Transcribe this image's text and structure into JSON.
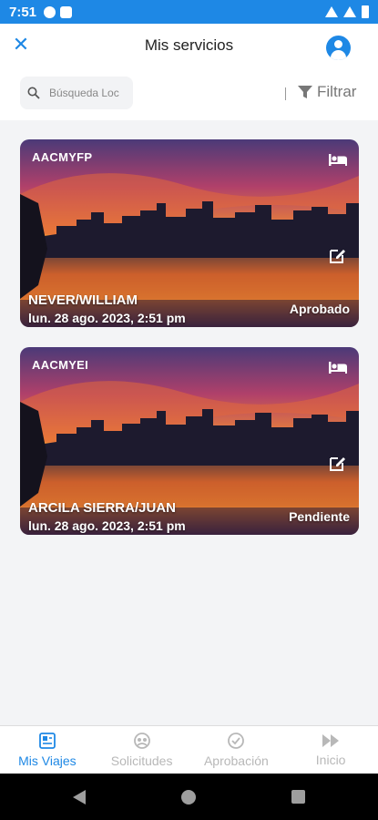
{
  "status_bar": {
    "time": "7:51"
  },
  "header": {
    "title": "Mis servicios",
    "search_placeholder": "Búsqueda Loc",
    "filter_label": "Filtrar"
  },
  "cards": [
    {
      "code": "AACMYFP",
      "name": "NEVER/WILLIAM",
      "date": "lun. 28 ago. 2023, 2:51 pm",
      "status": "Aprobado"
    },
    {
      "code": "AACMYEI",
      "name": "ARCILA SIERRA/JUAN",
      "date": "lun. 28 ago. 2023, 2:51 pm",
      "status": "Pendiente"
    }
  ],
  "bottom_nav": [
    {
      "label": "Mis Viajes",
      "icon": "trips-icon",
      "active": true
    },
    {
      "label": "Solicitudes",
      "icon": "requests-icon",
      "active": false
    },
    {
      "label": "Aprobación",
      "icon": "approval-icon",
      "active": false
    },
    {
      "label": "Inicio",
      "icon": "home-forward-icon",
      "active": false
    }
  ],
  "colors": {
    "accent": "#1e88e5",
    "inactive": "#b8b8b8"
  }
}
